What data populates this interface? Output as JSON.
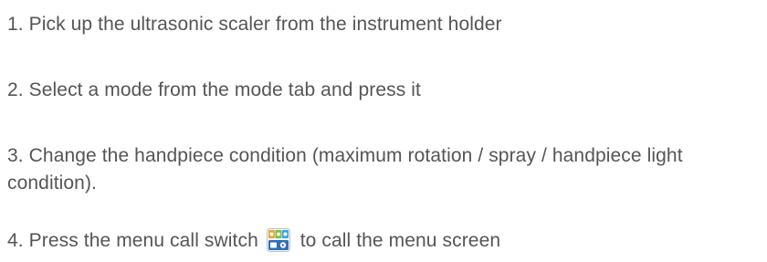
{
  "steps": [
    {
      "text": "1. Pick up the ultrasonic scaler from the instrument holder"
    },
    {
      "text": "2. Select a mode from the mode tab and press it"
    },
    {
      "text": "3. Change the handpiece condition (maximum rotation / spray / handpiece light condition)."
    },
    {
      "text_before": "4. Press the menu call switch",
      "icon": "menu-call-switch-icon",
      "text_after": "to call the menu screen"
    }
  ],
  "colors": {
    "text": "#555555",
    "icon_top_left": "#f2a23a",
    "icon_top_mid": "#7bbf3a",
    "icon_top_right": "#3aa6e0",
    "icon_bottom": "#2f6fb8"
  }
}
